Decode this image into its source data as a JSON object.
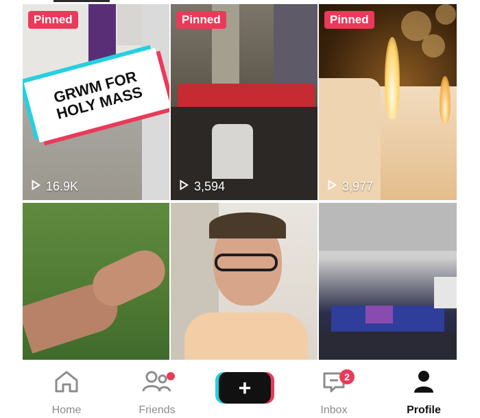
{
  "colors": {
    "accent_red": "#ea3a5a",
    "accent_cyan": "#25d0e0",
    "nav_text": "#8c8c8c",
    "nav_active": "#111111"
  },
  "grid": {
    "videos": [
      {
        "pinned_label": "Pinned",
        "views": "16.9K",
        "caption_line1": "GRWM FOR",
        "caption_line2": "HOLY MASS"
      },
      {
        "pinned_label": "Pinned",
        "views": "3,594"
      },
      {
        "pinned_label": "Pinned",
        "views": "3,977"
      },
      {},
      {},
      {}
    ]
  },
  "bottom_nav": {
    "home": {
      "label": "Home",
      "icon": "home-icon"
    },
    "friends": {
      "label": "Friends",
      "icon": "friends-icon",
      "has_dot": true
    },
    "create": {
      "label": "+",
      "icon": "plus-icon"
    },
    "inbox": {
      "label": "Inbox",
      "icon": "inbox-icon",
      "badge": "2"
    },
    "profile": {
      "label": "Profile",
      "icon": "profile-icon",
      "active": true
    }
  }
}
